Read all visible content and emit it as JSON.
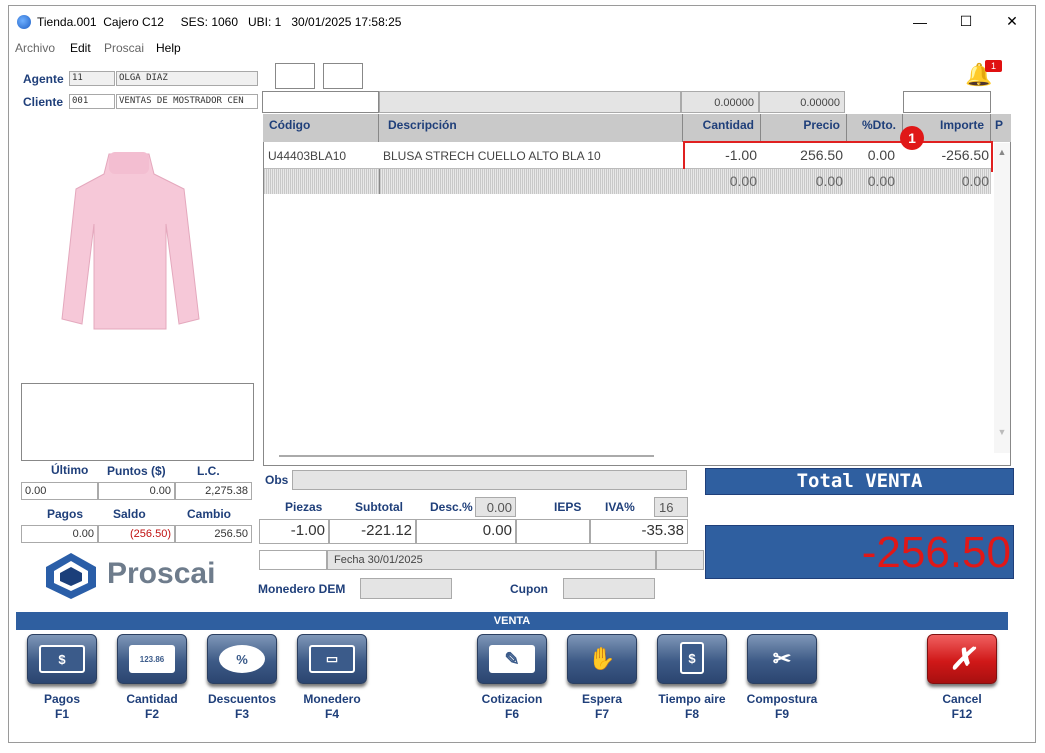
{
  "window": {
    "title": "Tienda.001  Cajero C12     SES: 1060   UBI: 1   30/01/2025 17:58:25"
  },
  "menu": [
    "Archivo",
    "Edit",
    "Proscai",
    "Help"
  ],
  "notification": {
    "count": "1"
  },
  "agente": {
    "label": "Agente",
    "code": "11",
    "name": "OLGA DIAZ"
  },
  "cliente": {
    "label": "Cliente",
    "code": "001",
    "name": "VENTAS DE MOSTRADOR CEN"
  },
  "top_totals": [
    "0.00000",
    "0.00000"
  ],
  "table": {
    "headers": [
      "Código",
      "Descripción",
      "Cantidad",
      "Precio",
      "%Dto.",
      "Importe",
      "P"
    ],
    "rows": [
      {
        "codigo": "U44403BLA10",
        "descripcion": "BLUSA STRECH CUELLO ALTO BLA 10",
        "cantidad": "-1.00",
        "precio": "256.50",
        "dto": "0.00",
        "importe": "-256.50"
      },
      {
        "codigo": "",
        "descripcion": "",
        "cantidad": "0.00",
        "precio": "0.00",
        "dto": "0.00",
        "importe": "0.00"
      }
    ]
  },
  "marker": "1",
  "stats": {
    "labels": [
      "Último",
      "Puntos ($)",
      "L.C."
    ],
    "values": [
      "0.00",
      "0.00",
      "2,275.38"
    ],
    "labels2": [
      "Pagos",
      "Saldo",
      "Cambio"
    ],
    "values2": [
      "0.00",
      "(256.50)",
      "256.50"
    ]
  },
  "brand": "Proscai",
  "obs": {
    "label": "Obs"
  },
  "summary": {
    "labels": [
      "Piezas",
      "Subtotal",
      "Desc.%",
      "IEPS",
      "IVA%"
    ],
    "desc_pct": "0.00",
    "iva_pct": "16",
    "piezas": "-1.00",
    "subtotal": "-221.12",
    "desc": "0.00",
    "iva": "-35.38"
  },
  "fecha": "Fecha 30/01/2025",
  "monedero": {
    "label": "Monedero DEM"
  },
  "cupon": {
    "label": "Cupon"
  },
  "total": {
    "label": "Total VENTA",
    "value": "-256.50"
  },
  "mode": "VENTA",
  "fkeys": [
    {
      "label": "Pagos",
      "key": "F1",
      "icon": "$"
    },
    {
      "label": "Cantidad",
      "key": "F2",
      "icon": "123.86"
    },
    {
      "label": "Descuentos",
      "key": "F3",
      "icon": "%"
    },
    {
      "label": "Monedero",
      "key": "F4",
      "icon": "▭"
    },
    {
      "label": "Cotizacion",
      "key": "F6",
      "icon": "✎"
    },
    {
      "label": "Espera",
      "key": "F7",
      "icon": "✋"
    },
    {
      "label": "Tiempo aire",
      "key": "F8",
      "icon": "$"
    },
    {
      "label": "Compostura",
      "key": "F9",
      "icon": "✂"
    },
    {
      "label": "Cancel",
      "key": "F12",
      "icon": "✗"
    }
  ],
  "colors": {
    "accent": "#1f3f7a",
    "total_red": "#e01818",
    "total_bg": "#2f5fa0",
    "cancel": "#d01818"
  }
}
